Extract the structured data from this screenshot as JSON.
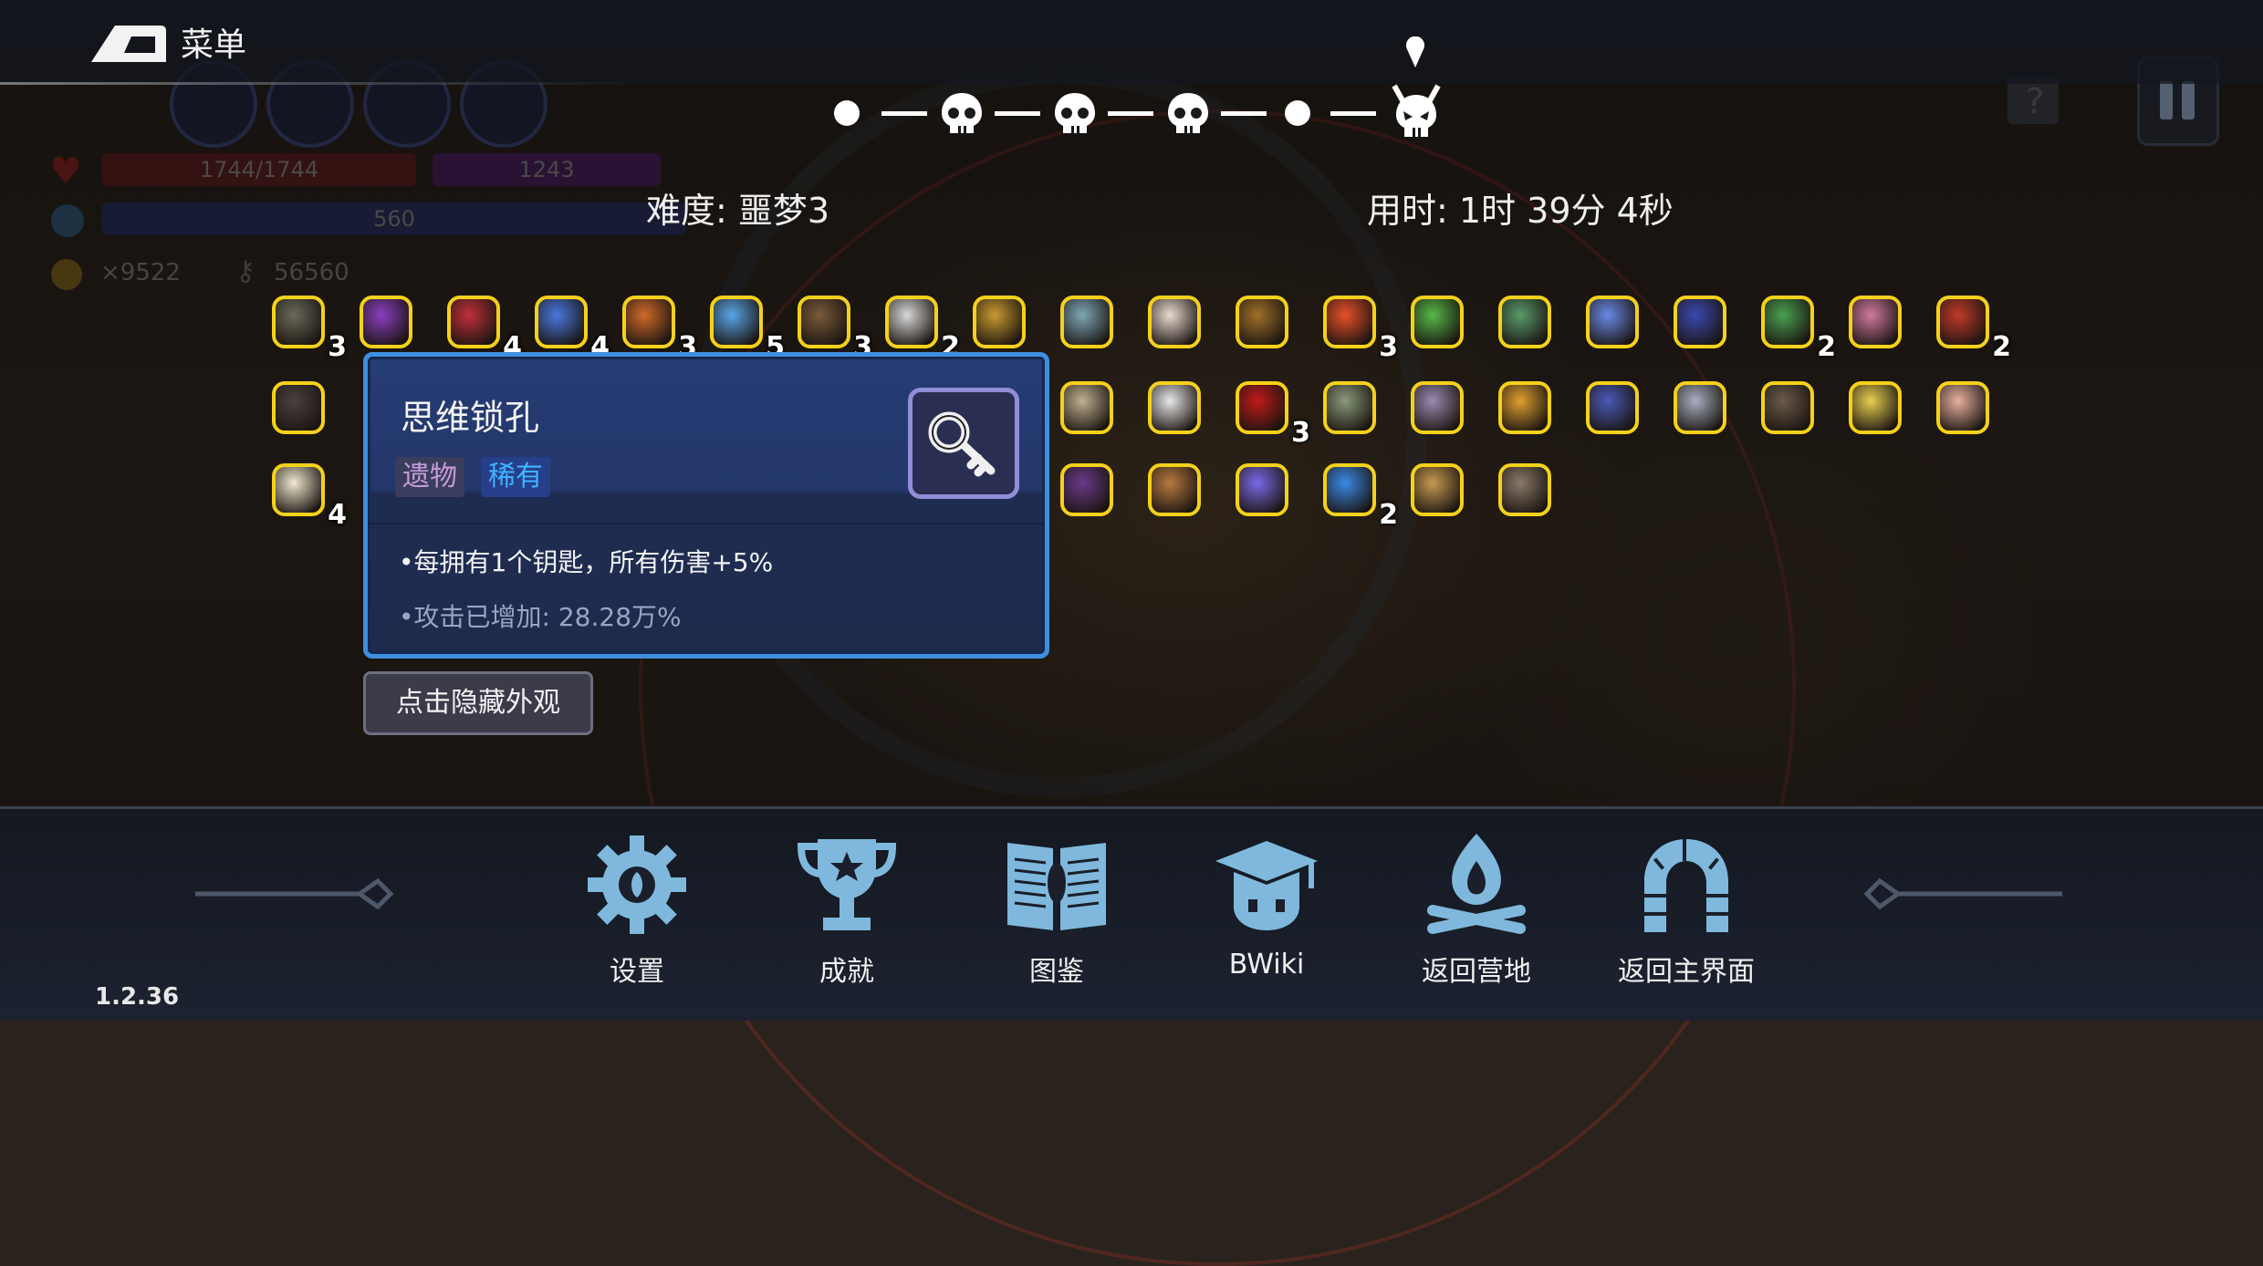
{
  "menu": {
    "label": "菜单"
  },
  "hud": {
    "hp": "1744/1744",
    "shield": "1243",
    "mana": "560",
    "gold": "×9522",
    "keys": "56560"
  },
  "route": {
    "nodes": [
      "dot",
      "skull",
      "skull",
      "skull",
      "dot",
      "demon-skull"
    ]
  },
  "difficulty": "难度: 噩梦3",
  "time": "用时: 1时 39分 4秒",
  "items": [
    {
      "icon": "plague-mask-icon",
      "count": "3",
      "color": "#6a6a5a"
    },
    {
      "icon": "wizard-hat-icon",
      "count": "",
      "color": "#8a3fc0"
    },
    {
      "icon": "demon-mask-icon",
      "count": "4",
      "color": "#c0303a"
    },
    {
      "icon": "blue-flower-icon",
      "count": "4",
      "color": "#4a78e0"
    },
    {
      "icon": "potion-bottle-icon",
      "count": "3",
      "color": "#d06a2a"
    },
    {
      "icon": "magnifier-icon",
      "count": "5",
      "color": "#5aa6e8"
    },
    {
      "icon": "branch-icon",
      "count": "3",
      "color": "#7a5a3a"
    },
    {
      "icon": "dragonfly-icon",
      "count": "2",
      "color": "#d8d8d8"
    },
    {
      "icon": "golden-leaf-icon",
      "count": "",
      "color": "#c89a30"
    },
    {
      "icon": "compass-icon",
      "count": "",
      "color": "#7fa8b8"
    },
    {
      "icon": "wings-icon",
      "count": "",
      "color": "#eadbd0"
    },
    {
      "icon": "treasure-chest-icon",
      "count": "",
      "color": "#a0702a"
    },
    {
      "icon": "heart-icon",
      "count": "3",
      "color": "#e8502a"
    },
    {
      "icon": "green-sprout-icon",
      "count": "",
      "color": "#58b848"
    },
    {
      "icon": "root-icon",
      "count": "",
      "color": "#5a9a6a"
    },
    {
      "icon": "crystal-icon",
      "count": "",
      "color": "#6a8ae8"
    },
    {
      "icon": "vial-icon",
      "count": "",
      "color": "#3a4ab0"
    },
    {
      "icon": "leaf-icon",
      "count": "2",
      "color": "#4aa050"
    },
    {
      "icon": "brain-icon",
      "count": "",
      "color": "#d07aa0"
    },
    {
      "icon": "red-eye-icon",
      "count": "2",
      "color": "#c03a2a"
    },
    {
      "icon": "black-helmet-icon",
      "count": "",
      "color": "#4a4040"
    },
    {
      "icon": "goggles-icon",
      "count": "",
      "color": "#c0b090"
    },
    {
      "icon": "key-icon",
      "count": "",
      "color": "#e8e8e8"
    },
    {
      "icon": "red-orb-icon",
      "count": "3",
      "color": "#c01a1a"
    },
    {
      "icon": "sword-icon",
      "count": "",
      "color": "#8a9a7a"
    },
    {
      "icon": "claw-icon",
      "count": "",
      "color": "#9a8ab0"
    },
    {
      "icon": "scroll-icon",
      "count": "",
      "color": "#e0a030"
    },
    {
      "icon": "gauntlet-icon",
      "count": "",
      "color": "#4a5ab8"
    },
    {
      "icon": "spear-icon",
      "count": "",
      "color": "#a8b0c0"
    },
    {
      "icon": "armor-icon",
      "count": "",
      "color": "#6a5a4a"
    },
    {
      "icon": "rainbow-bar-icon",
      "count": "",
      "color": "#e8d050"
    },
    {
      "icon": "pig-icon",
      "count": "",
      "color": "#e8b0a0"
    },
    {
      "icon": "candy-corn-icon",
      "count": "4",
      "color": "#f0e8d0"
    },
    {
      "icon": "spellbook-icon",
      "count": "",
      "color": "#6a3a8a"
    },
    {
      "icon": "sarcophagus-icon",
      "count": "",
      "color": "#b87a40"
    },
    {
      "icon": "mana-crystal-icon",
      "count": "",
      "color": "#7a6ae8"
    },
    {
      "icon": "blue-ring-icon",
      "count": "2",
      "color": "#3a8ae8"
    },
    {
      "icon": "hourglass-icon",
      "count": "",
      "color": "#c89a50"
    },
    {
      "icon": "bone-icon",
      "count": "",
      "color": "#8a7a6a"
    }
  ],
  "tooltip": {
    "title": "思维锁孔",
    "tag_type": "遗物",
    "tag_rarity": "稀有",
    "description": "•每拥有1个钥匙，所有伤害+5%",
    "bonus": "•攻击已增加: 28.28万%",
    "icon": "key-icon"
  },
  "hide_button": "点击隐藏外观",
  "nav": [
    {
      "icon": "settings-gear-icon",
      "label": "设置"
    },
    {
      "icon": "trophy-icon",
      "label": "成就"
    },
    {
      "icon": "codex-book-icon",
      "label": "图鉴"
    },
    {
      "icon": "graduation-cap-icon",
      "label": "BWiki"
    },
    {
      "icon": "campfire-icon",
      "label": "返回营地"
    },
    {
      "icon": "arch-icon",
      "label": "返回主界面"
    }
  ],
  "version": "1.2.36",
  "colors": {
    "tooltip_border": "#3e8fe0",
    "item_border": "#f5d11a",
    "nav_icon": "#7fb8dc"
  }
}
